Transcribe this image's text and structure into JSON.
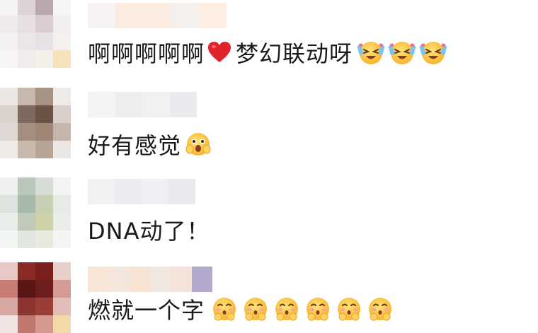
{
  "comments": [
    {
      "text_before": "啊啊啊啊啊",
      "heart": "red-heart-icon",
      "text_after": "梦幻联动呀",
      "emojis": [
        "crying-laughing-face-icon",
        "crying-laughing-face-icon",
        "crying-laughing-face-icon"
      ]
    },
    {
      "text": "好有感觉",
      "emojis": [
        "shocked-face-icon"
      ]
    },
    {
      "text": "DNA动了！",
      "emojis": []
    },
    {
      "text": "燃就一个字",
      "emojis": [
        "shy-blushing-face-icon",
        "shy-blushing-face-icon",
        "shy-blushing-face-icon",
        "shy-blushing-face-icon",
        "shy-blushing-face-icon",
        "shy-blushing-face-icon"
      ]
    }
  ],
  "colors": {
    "text": "#1a1a1a",
    "heart": "#e0242b",
    "emoji_face": "#ffc93a",
    "emoji_blush": "#f7a5a0"
  }
}
